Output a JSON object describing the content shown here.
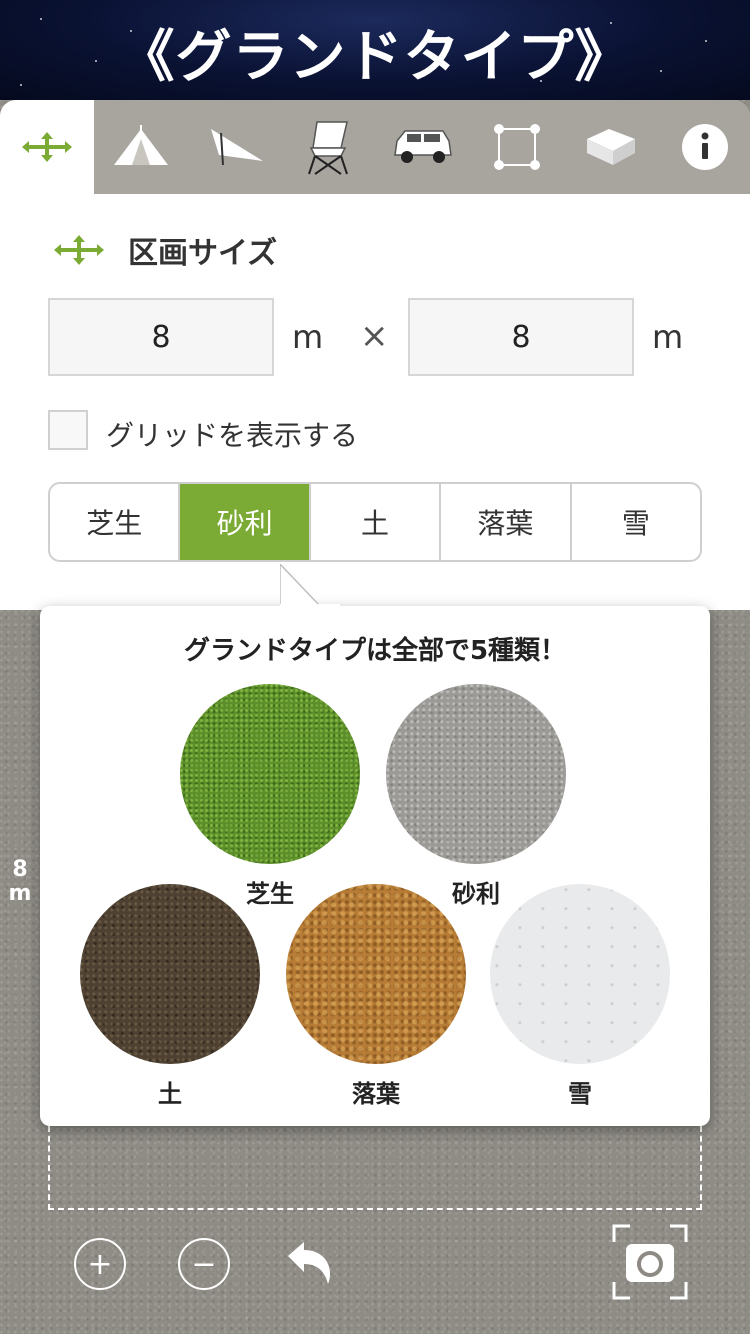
{
  "header": {
    "title": "《グランドタイプ》"
  },
  "toolbar": {
    "tools": [
      {
        "icon": "move-arrows-icon"
      },
      {
        "icon": "tent-icon"
      },
      {
        "icon": "tarp-icon"
      },
      {
        "icon": "chair-icon"
      },
      {
        "icon": "car-icon"
      },
      {
        "icon": "area-select-icon"
      },
      {
        "icon": "storage-box-icon"
      },
      {
        "icon": "info-icon",
        "label": "i"
      }
    ]
  },
  "panel": {
    "section_title": "区画サイズ",
    "width_value": "8",
    "depth_value": "8",
    "unit": "m",
    "times": "×",
    "grid_label": "グリッドを表示する",
    "ground_types": [
      "芝生",
      "砂利",
      "土",
      "落葉",
      "雪"
    ],
    "selected_ground": "砂利"
  },
  "popover": {
    "title": "グランドタイプは全部で5種類！",
    "swatches": [
      "芝生",
      "砂利",
      "土",
      "落葉",
      "雪"
    ]
  },
  "canvas": {
    "side_dimension_number": "8",
    "side_dimension_unit": "m"
  },
  "bottom": {
    "zoom_in": "+",
    "zoom_out": "−"
  },
  "colors": {
    "accent": "#7cab35",
    "header_bg": "#0a1233"
  }
}
